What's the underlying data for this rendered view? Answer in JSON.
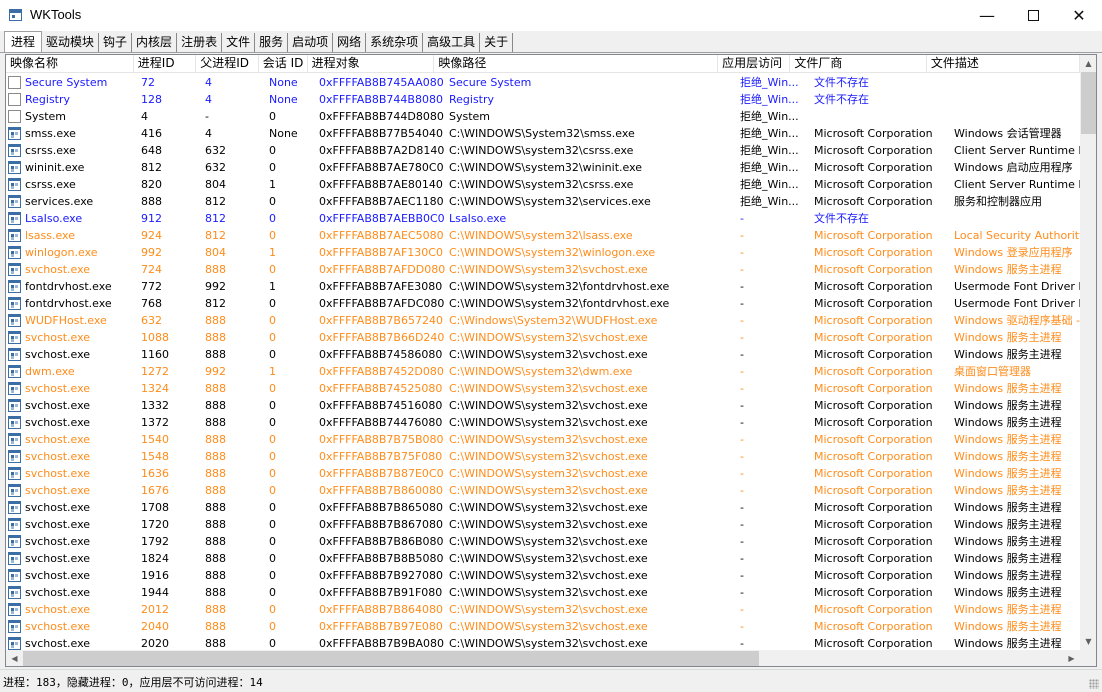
{
  "window": {
    "title": "WKTools",
    "minimize": "—",
    "close": "✕"
  },
  "tabs": [
    "进程",
    "驱动模块",
    "钩子",
    "内核层",
    "注册表",
    "文件",
    "服务",
    "启动项",
    "网络",
    "系统杂项",
    "高级工具",
    "关于"
  ],
  "active_tab": 0,
  "table": {
    "columns": [
      "映像名称",
      "进程ID",
      "父进程ID",
      "会话 ID",
      "进程对象",
      "映像路径",
      "应用层访问",
      "文件厂商",
      "文件描述"
    ],
    "rows": [
      {
        "name": "Secure System",
        "pid": "72",
        "ppid": "4",
        "session": "None",
        "obj": "0xFFFFAB8B745AA080",
        "path": "Secure System",
        "access": "拒绝_Win...",
        "vendor": "文件不存在",
        "desc": "",
        "color": "blue",
        "icon": "doc"
      },
      {
        "name": "Registry",
        "pid": "128",
        "ppid": "4",
        "session": "None",
        "obj": "0xFFFFAB8B744B8080",
        "path": "Registry",
        "access": "拒绝_Win...",
        "vendor": "文件不存在",
        "desc": "",
        "color": "blue",
        "icon": "doc"
      },
      {
        "name": "System",
        "pid": "4",
        "ppid": "-",
        "session": "0",
        "obj": "0xFFFFAB8B744D8080",
        "path": "System",
        "access": "拒绝_Win...",
        "vendor": "",
        "desc": "",
        "color": "black",
        "icon": "doc"
      },
      {
        "name": "smss.exe",
        "pid": "416",
        "ppid": "4",
        "session": "None",
        "obj": "0xFFFFAB8B77B54040",
        "path": "C:\\WINDOWS\\System32\\smss.exe",
        "access": "拒绝_Win...",
        "vendor": "Microsoft Corporation",
        "desc": "Windows 会话管理器",
        "color": "black",
        "icon": "exe"
      },
      {
        "name": "csrss.exe",
        "pid": "648",
        "ppid": "632",
        "session": "0",
        "obj": "0xFFFFAB8B7A2D8140",
        "path": "C:\\WINDOWS\\system32\\csrss.exe",
        "access": "拒绝_Win...",
        "vendor": "Microsoft Corporation",
        "desc": "Client Server Runtime Process",
        "color": "black",
        "icon": "exe"
      },
      {
        "name": "wininit.exe",
        "pid": "812",
        "ppid": "632",
        "session": "0",
        "obj": "0xFFFFAB8B7AE780C0",
        "path": "C:\\WINDOWS\\system32\\wininit.exe",
        "access": "拒绝_Win...",
        "vendor": "Microsoft Corporation",
        "desc": "Windows 启动应用程序",
        "color": "black",
        "icon": "exe"
      },
      {
        "name": "csrss.exe",
        "pid": "820",
        "ppid": "804",
        "session": "1",
        "obj": "0xFFFFAB8B7AE80140",
        "path": "C:\\WINDOWS\\system32\\csrss.exe",
        "access": "拒绝_Win...",
        "vendor": "Microsoft Corporation",
        "desc": "Client Server Runtime Process",
        "color": "black",
        "icon": "exe"
      },
      {
        "name": "services.exe",
        "pid": "888",
        "ppid": "812",
        "session": "0",
        "obj": "0xFFFFAB8B7AEC1180",
        "path": "C:\\WINDOWS\\system32\\services.exe",
        "access": "拒绝_Win...",
        "vendor": "Microsoft Corporation",
        "desc": "服务和控制器应用",
        "color": "black",
        "icon": "exe"
      },
      {
        "name": "LsaIso.exe",
        "pid": "912",
        "ppid": "812",
        "session": "0",
        "obj": "0xFFFFAB8B7AEBB0C0",
        "path": "LsaIso.exe",
        "access": "-",
        "vendor": "文件不存在",
        "desc": "",
        "color": "blue",
        "icon": "exe"
      },
      {
        "name": "lsass.exe",
        "pid": "924",
        "ppid": "812",
        "session": "0",
        "obj": "0xFFFFAB8B7AEC5080",
        "path": "C:\\WINDOWS\\system32\\lsass.exe",
        "access": "-",
        "vendor": "Microsoft Corporation",
        "desc": "Local Security Authority Process",
        "color": "orange",
        "icon": "exe"
      },
      {
        "name": "winlogon.exe",
        "pid": "992",
        "ppid": "804",
        "session": "1",
        "obj": "0xFFFFAB8B7AF130C0",
        "path": "C:\\WINDOWS\\system32\\winlogon.exe",
        "access": "-",
        "vendor": "Microsoft Corporation",
        "desc": "Windows 登录应用程序",
        "color": "orange",
        "icon": "exe"
      },
      {
        "name": "svchost.exe",
        "pid": "724",
        "ppid": "888",
        "session": "0",
        "obj": "0xFFFFAB8B7AFDD080",
        "path": "C:\\WINDOWS\\system32\\svchost.exe",
        "access": "-",
        "vendor": "Microsoft Corporation",
        "desc": "Windows 服务主进程",
        "color": "orange",
        "icon": "exe"
      },
      {
        "name": "fontdrvhost.exe",
        "pid": "772",
        "ppid": "992",
        "session": "1",
        "obj": "0xFFFFAB8B7AFE3080",
        "path": "C:\\WINDOWS\\system32\\fontdrvhost.exe",
        "access": "-",
        "vendor": "Microsoft Corporation",
        "desc": "Usermode Font Driver Host",
        "color": "black",
        "icon": "exe"
      },
      {
        "name": "fontdrvhost.exe",
        "pid": "768",
        "ppid": "812",
        "session": "0",
        "obj": "0xFFFFAB8B7AFDC080",
        "path": "C:\\WINDOWS\\system32\\fontdrvhost.exe",
        "access": "-",
        "vendor": "Microsoft Corporation",
        "desc": "Usermode Font Driver Host",
        "color": "black",
        "icon": "exe"
      },
      {
        "name": "WUDFHost.exe",
        "pid": "632",
        "ppid": "888",
        "session": "0",
        "obj": "0xFFFFAB8B7B657240",
        "path": "C:\\Windows\\System32\\WUDFHost.exe",
        "access": "-",
        "vendor": "Microsoft Corporation",
        "desc": "Windows 驱动程序基础 - 用户模式驱动程序框架主机进程",
        "color": "orange",
        "icon": "exe"
      },
      {
        "name": "svchost.exe",
        "pid": "1088",
        "ppid": "888",
        "session": "0",
        "obj": "0xFFFFAB8B7B66D240",
        "path": "C:\\WINDOWS\\system32\\svchost.exe",
        "access": "-",
        "vendor": "Microsoft Corporation",
        "desc": "Windows 服务主进程",
        "color": "orange",
        "icon": "exe"
      },
      {
        "name": "svchost.exe",
        "pid": "1160",
        "ppid": "888",
        "session": "0",
        "obj": "0xFFFFAB8B74586080",
        "path": "C:\\WINDOWS\\system32\\svchost.exe",
        "access": "-",
        "vendor": "Microsoft Corporation",
        "desc": "Windows 服务主进程",
        "color": "black",
        "icon": "exe"
      },
      {
        "name": "dwm.exe",
        "pid": "1272",
        "ppid": "992",
        "session": "1",
        "obj": "0xFFFFAB8B7452D080",
        "path": "C:\\WINDOWS\\system32\\dwm.exe",
        "access": "-",
        "vendor": "Microsoft Corporation",
        "desc": "桌面窗口管理器",
        "color": "orange",
        "icon": "exe"
      },
      {
        "name": "svchost.exe",
        "pid": "1324",
        "ppid": "888",
        "session": "0",
        "obj": "0xFFFFAB8B74525080",
        "path": "C:\\WINDOWS\\system32\\svchost.exe",
        "access": "-",
        "vendor": "Microsoft Corporation",
        "desc": "Windows 服务主进程",
        "color": "orange",
        "icon": "exe"
      },
      {
        "name": "svchost.exe",
        "pid": "1332",
        "ppid": "888",
        "session": "0",
        "obj": "0xFFFFAB8B74516080",
        "path": "C:\\WINDOWS\\system32\\svchost.exe",
        "access": "-",
        "vendor": "Microsoft Corporation",
        "desc": "Windows 服务主进程",
        "color": "black",
        "icon": "exe"
      },
      {
        "name": "svchost.exe",
        "pid": "1372",
        "ppid": "888",
        "session": "0",
        "obj": "0xFFFFAB8B74476080",
        "path": "C:\\WINDOWS\\system32\\svchost.exe",
        "access": "-",
        "vendor": "Microsoft Corporation",
        "desc": "Windows 服务主进程",
        "color": "black",
        "icon": "exe"
      },
      {
        "name": "svchost.exe",
        "pid": "1540",
        "ppid": "888",
        "session": "0",
        "obj": "0xFFFFAB8B7B75B080",
        "path": "C:\\WINDOWS\\system32\\svchost.exe",
        "access": "-",
        "vendor": "Microsoft Corporation",
        "desc": "Windows 服务主进程",
        "color": "orange",
        "icon": "exe"
      },
      {
        "name": "svchost.exe",
        "pid": "1548",
        "ppid": "888",
        "session": "0",
        "obj": "0xFFFFAB8B7B75F080",
        "path": "C:\\WINDOWS\\system32\\svchost.exe",
        "access": "-",
        "vendor": "Microsoft Corporation",
        "desc": "Windows 服务主进程",
        "color": "orange",
        "icon": "exe"
      },
      {
        "name": "svchost.exe",
        "pid": "1636",
        "ppid": "888",
        "session": "0",
        "obj": "0xFFFFAB8B7B87E0C0",
        "path": "C:\\WINDOWS\\system32\\svchost.exe",
        "access": "-",
        "vendor": "Microsoft Corporation",
        "desc": "Windows 服务主进程",
        "color": "orange",
        "icon": "exe"
      },
      {
        "name": "svchost.exe",
        "pid": "1676",
        "ppid": "888",
        "session": "0",
        "obj": "0xFFFFAB8B7B860080",
        "path": "C:\\WINDOWS\\system32\\svchost.exe",
        "access": "-",
        "vendor": "Microsoft Corporation",
        "desc": "Windows 服务主进程",
        "color": "orange",
        "icon": "exe"
      },
      {
        "name": "svchost.exe",
        "pid": "1708",
        "ppid": "888",
        "session": "0",
        "obj": "0xFFFFAB8B7B865080",
        "path": "C:\\WINDOWS\\system32\\svchost.exe",
        "access": "-",
        "vendor": "Microsoft Corporation",
        "desc": "Windows 服务主进程",
        "color": "black",
        "icon": "exe"
      },
      {
        "name": "svchost.exe",
        "pid": "1720",
        "ppid": "888",
        "session": "0",
        "obj": "0xFFFFAB8B7B867080",
        "path": "C:\\WINDOWS\\system32\\svchost.exe",
        "access": "-",
        "vendor": "Microsoft Corporation",
        "desc": "Windows 服务主进程",
        "color": "black",
        "icon": "exe"
      },
      {
        "name": "svchost.exe",
        "pid": "1792",
        "ppid": "888",
        "session": "0",
        "obj": "0xFFFFAB8B7B86B080",
        "path": "C:\\WINDOWS\\system32\\svchost.exe",
        "access": "-",
        "vendor": "Microsoft Corporation",
        "desc": "Windows 服务主进程",
        "color": "black",
        "icon": "exe"
      },
      {
        "name": "svchost.exe",
        "pid": "1824",
        "ppid": "888",
        "session": "0",
        "obj": "0xFFFFAB8B7B8B5080",
        "path": "C:\\WINDOWS\\system32\\svchost.exe",
        "access": "-",
        "vendor": "Microsoft Corporation",
        "desc": "Windows 服务主进程",
        "color": "black",
        "icon": "exe"
      },
      {
        "name": "svchost.exe",
        "pid": "1916",
        "ppid": "888",
        "session": "0",
        "obj": "0xFFFFAB8B7B927080",
        "path": "C:\\WINDOWS\\system32\\svchost.exe",
        "access": "-",
        "vendor": "Microsoft Corporation",
        "desc": "Windows 服务主进程",
        "color": "black",
        "icon": "exe"
      },
      {
        "name": "svchost.exe",
        "pid": "1944",
        "ppid": "888",
        "session": "0",
        "obj": "0xFFFFAB8B7B91F080",
        "path": "C:\\WINDOWS\\system32\\svchost.exe",
        "access": "-",
        "vendor": "Microsoft Corporation",
        "desc": "Windows 服务主进程",
        "color": "black",
        "icon": "exe"
      },
      {
        "name": "svchost.exe",
        "pid": "2012",
        "ppid": "888",
        "session": "0",
        "obj": "0xFFFFAB8B7B864080",
        "path": "C:\\WINDOWS\\system32\\svchost.exe",
        "access": "-",
        "vendor": "Microsoft Corporation",
        "desc": "Windows 服务主进程",
        "color": "orange",
        "icon": "exe"
      },
      {
        "name": "svchost.exe",
        "pid": "2040",
        "ppid": "888",
        "session": "0",
        "obj": "0xFFFFAB8B7B97E080",
        "path": "C:\\WINDOWS\\system32\\svchost.exe",
        "access": "-",
        "vendor": "Microsoft Corporation",
        "desc": "Windows 服务主进程",
        "color": "orange",
        "icon": "exe"
      },
      {
        "name": "svchost.exe",
        "pid": "2020",
        "ppid": "888",
        "session": "0",
        "obj": "0xFFFFAB8B7B9BA080",
        "path": "C:\\WINDOWS\\system32\\svchost.exe",
        "access": "-",
        "vendor": "Microsoft Corporation",
        "desc": "Windows 服务主进程",
        "color": "black",
        "icon": "exe"
      }
    ]
  },
  "colors": {
    "blue": "#1a1aff",
    "orange": "#ff8c1a",
    "black": "#000000"
  },
  "status": {
    "text": "进程：183，隐藏进程：0，应用层不可访问进程：14"
  }
}
